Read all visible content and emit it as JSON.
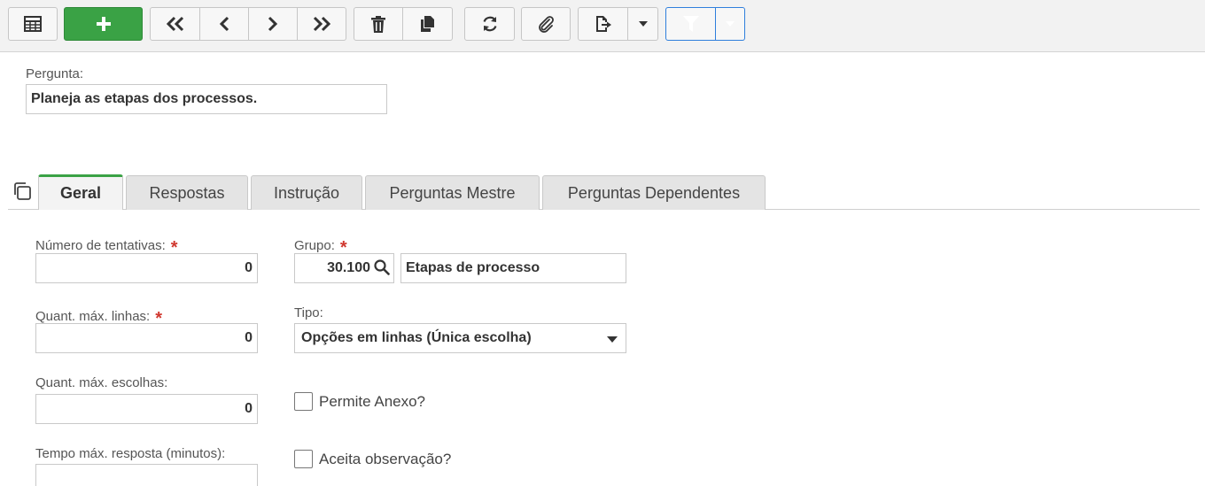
{
  "toolbar": {
    "buttons": [
      {
        "name": "grid-view",
        "icon": "table-icon"
      },
      {
        "name": "add",
        "icon": "plus-icon"
      },
      {
        "name": "first",
        "icon": "double-chevron-left-icon"
      },
      {
        "name": "previous",
        "icon": "chevron-left-icon"
      },
      {
        "name": "next",
        "icon": "chevron-right-icon"
      },
      {
        "name": "last",
        "icon": "double-chevron-right-icon"
      },
      {
        "name": "delete",
        "icon": "trash-icon"
      },
      {
        "name": "copy",
        "icon": "copy-icon"
      },
      {
        "name": "refresh",
        "icon": "refresh-icon"
      },
      {
        "name": "attach",
        "icon": "paperclip-icon"
      },
      {
        "name": "export",
        "icon": "file-export-icon"
      },
      {
        "name": "filter",
        "icon": "funnel-icon"
      }
    ],
    "accent_add": "#3aa245",
    "accent_filter": "#3b8ff0"
  },
  "question": {
    "label": "Pergunta:",
    "value": "Planeja as etapas dos processos."
  },
  "tabs": [
    {
      "label": "Geral",
      "active": true
    },
    {
      "label": "Respostas",
      "active": false
    },
    {
      "label": "Instrução",
      "active": false
    },
    {
      "label": "Perguntas Mestre",
      "active": false
    },
    {
      "label": "Perguntas Dependentes",
      "active": false
    }
  ],
  "form": {
    "attempts": {
      "label": "Número de tentativas:",
      "required_mark": "*",
      "value": "0"
    },
    "max_lines": {
      "label": "Quant. máx. linhas:",
      "required_mark": "*",
      "value": "0"
    },
    "max_choices": {
      "label": "Quant. máx. escolhas:",
      "value": "0"
    },
    "max_time": {
      "label": "Tempo máx. resposta (minutos):",
      "value": ""
    },
    "group": {
      "label": "Grupo:",
      "required_mark": "*",
      "code": "30.100",
      "description": "Etapas de processo"
    },
    "type": {
      "label": "Tipo:",
      "value": "Opções em linhas (Única escolha)"
    },
    "allow_attachment": {
      "label": "Permite Anexo?",
      "checked": false
    },
    "accept_observation": {
      "label": "Aceita observação?",
      "checked": false
    }
  }
}
